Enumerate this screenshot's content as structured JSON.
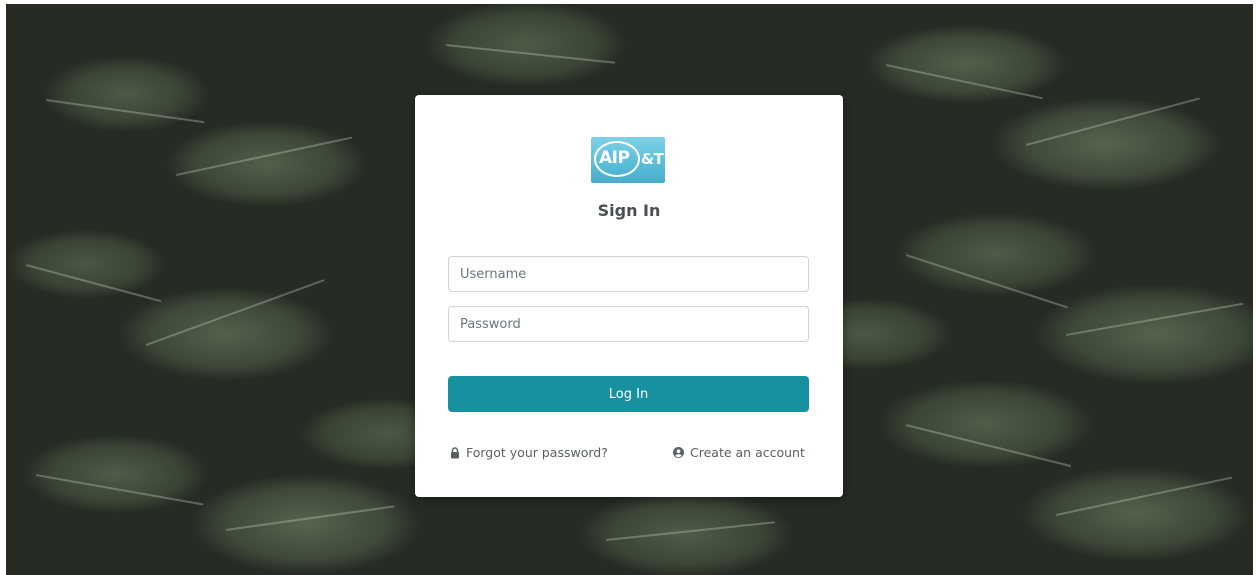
{
  "logo": {
    "main_text": "AIP",
    "suffix_text": "&T",
    "colors": {
      "background": "#5bbfd9",
      "text": "#ffffff"
    }
  },
  "login": {
    "title": "Sign In",
    "username_placeholder": "Username",
    "password_placeholder": "Password",
    "submit_label": "Log In",
    "forgot_label": "Forgot your password?",
    "create_label": "Create an account"
  },
  "icons": {
    "forgot": "lock-icon",
    "create": "user-circle-icon"
  },
  "colors": {
    "primary_button": "#17919f",
    "card_background": "#ffffff",
    "link_text": "#5a6066"
  }
}
